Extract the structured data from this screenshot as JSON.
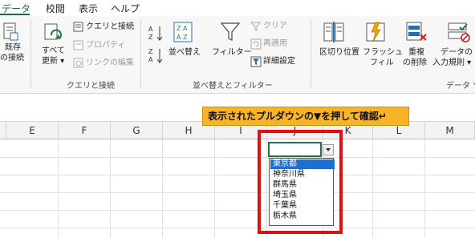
{
  "menu_tabs": [
    {
      "label": "データ",
      "active": true
    },
    {
      "label": "校閲",
      "active": false
    },
    {
      "label": "表示",
      "active": false
    },
    {
      "label": "ヘルプ",
      "active": false
    }
  ],
  "ribbon": {
    "existing_connection": {
      "line1": "既存",
      "line2": "の接続"
    },
    "refresh_all": {
      "line1": "すべて",
      "line2": "更新 ▾"
    },
    "queries_connections": "クエリと接続",
    "properties": "プロパティ",
    "edit_links": "リンクの編集",
    "group_query": "クエリと接続",
    "sort_label": "並べ替え",
    "filter_label": "フィルター",
    "clear_label": "クリア",
    "reapply_label": "再適用",
    "advanced_label": "詳細設定",
    "group_sort": "並べ替えとフィルター",
    "text_to_columns": "区切り位置",
    "flash_fill": {
      "line1": "フラッシュ",
      "line2": "フィル"
    },
    "remove_duplicates": {
      "line1": "重複",
      "line2": "の削除"
    },
    "data_validation": {
      "line1": "データの",
      "line2": "入力規則 ▾"
    },
    "group_data": "データ ツ"
  },
  "columns": [
    "E",
    "F",
    "G",
    "H",
    "I",
    "J",
    "K",
    "L",
    "M"
  ],
  "callout": "表示されたプルダウンの▼を押して確認↵",
  "dropdown": {
    "items": [
      "東京都",
      "神奈川県",
      "群馬県",
      "埼玉県",
      "千葉県",
      "栃木県"
    ],
    "selected_index": 0
  },
  "colors": {
    "accent": "#1e6b3a",
    "callout_bg": "#f8b326",
    "highlight_border": "#e01010",
    "selection": "#1f6fd1"
  }
}
